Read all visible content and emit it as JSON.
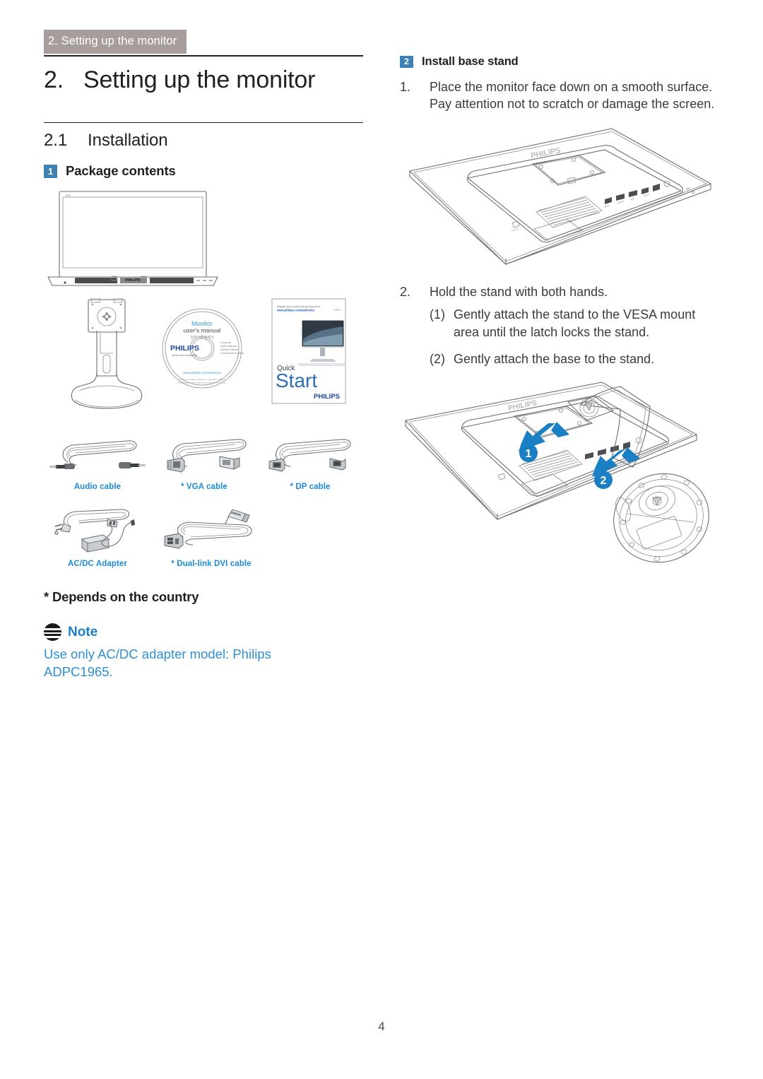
{
  "header": {
    "breadcrumb": "2. Setting up the monitor"
  },
  "chapter": {
    "number": "2.",
    "title": "Setting up the monitor"
  },
  "section": {
    "number": "2.1",
    "title": "Installation"
  },
  "left": {
    "package_contents": {
      "badge": "1",
      "label": "Package contents"
    },
    "illustrations": {
      "monitor_alt": "monitor-front-line-art",
      "stand_alt": "monitor-stand-line-art",
      "cd": {
        "title_line1": "Monitor",
        "title_line2": "user's manual",
        "brand": "PHILIPS"
      },
      "quick_start": {
        "kicker": "Register your product and get support at",
        "url": "www.philips.com/welcome",
        "word1": "Quick",
        "word2": "Start",
        "brand": "PHILIPS"
      }
    },
    "cables_row1": [
      {
        "label": "Audio cable",
        "icon": "audio-cable-icon"
      },
      {
        "label": "* VGA cable",
        "icon": "vga-cable-icon"
      },
      {
        "label": "* DP cable",
        "icon": "dp-cable-icon"
      }
    ],
    "cables_row2": [
      {
        "label": "AC/DC Adapter",
        "icon": "ac-dc-adapter-icon"
      },
      {
        "label": "* Dual-link DVI cable",
        "icon": "dvi-cable-icon"
      }
    ],
    "footnote": "* Depends on the country",
    "note": {
      "icon": "note-icon",
      "title": "Note",
      "body": "Use only AC/DC adapter model: Philips ADPC1965."
    }
  },
  "right": {
    "install_base_stand": {
      "badge": "2",
      "label": "Install base stand"
    },
    "steps": [
      {
        "marker": "1.",
        "text": "Place the monitor face down on a smooth surface. Pay attention not to scratch or damage the screen."
      },
      {
        "marker": "2.",
        "text": "Hold the stand with both hands."
      }
    ],
    "substeps": [
      {
        "marker": "(1)",
        "text": "Gently attach the stand to the VESA mount area until the latch locks the stand."
      },
      {
        "marker": "(2)",
        "text": "Gently attach the base to the stand."
      }
    ],
    "illustrations": {
      "monitor_back_alt": "monitor-back-face-down-line-art",
      "stand_attach_alt": "stand-base-attach-line-art",
      "brand_emboss": "PHILIPS",
      "arrow_labels": [
        "1",
        "2"
      ]
    }
  },
  "footer": {
    "page_number": "4"
  },
  "colors": {
    "breadcrumb_bg": "#a79d9b",
    "badge_blue": "#3d82b5",
    "cable_label_blue": "#1b8ad6",
    "note_title_blue": "#1b7fc4",
    "note_body_blue": "#2e8fd4",
    "arrow_blue": "#1b7fc4",
    "line_art": "#6d6e71",
    "text": "#231f20"
  }
}
